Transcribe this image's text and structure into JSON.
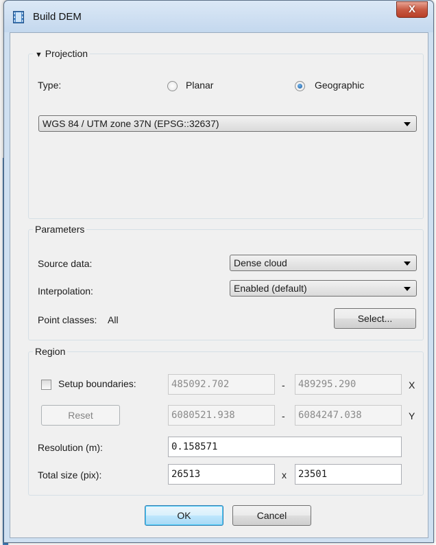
{
  "window": {
    "title": "Build DEM",
    "close_glyph": "X"
  },
  "projection": {
    "legend": "Projection",
    "collapse_glyph": "▼",
    "type_label": "Type:",
    "options": [
      "Planar",
      "Geographic"
    ],
    "selected": "Geographic",
    "crs": "WGS 84 / UTM zone 37N (EPSG::32637)"
  },
  "parameters": {
    "legend": "Parameters",
    "source_label": "Source data:",
    "source_value": "Dense cloud",
    "interp_label": "Interpolation:",
    "interp_value": "Enabled (default)",
    "classes_label": "Point classes:",
    "classes_value": "All",
    "select_button": "Select..."
  },
  "region": {
    "legend": "Region",
    "setup_label": "Setup boundaries:",
    "setup_checked": false,
    "reset_button": "Reset",
    "x_min": "485092.702",
    "x_max": "489295.290",
    "y_min": "6080521.938",
    "y_max": "6084247.038",
    "dash": "-",
    "x_axis": "X",
    "y_axis": "Y",
    "resolution_label": "Resolution (m):",
    "resolution_value": "0.158571",
    "total_label": "Total size (pix):",
    "total_w": "26513",
    "times": "x",
    "total_h": "23501"
  },
  "footer": {
    "ok": "OK",
    "cancel": "Cancel"
  },
  "colors": {
    "titlebar": "#c4d8ee",
    "close": "#c85a43",
    "dialog_bg": "#f0f0f0",
    "radio_selected": "#1c5a9e"
  },
  "icons": {
    "title": "film-icon"
  }
}
